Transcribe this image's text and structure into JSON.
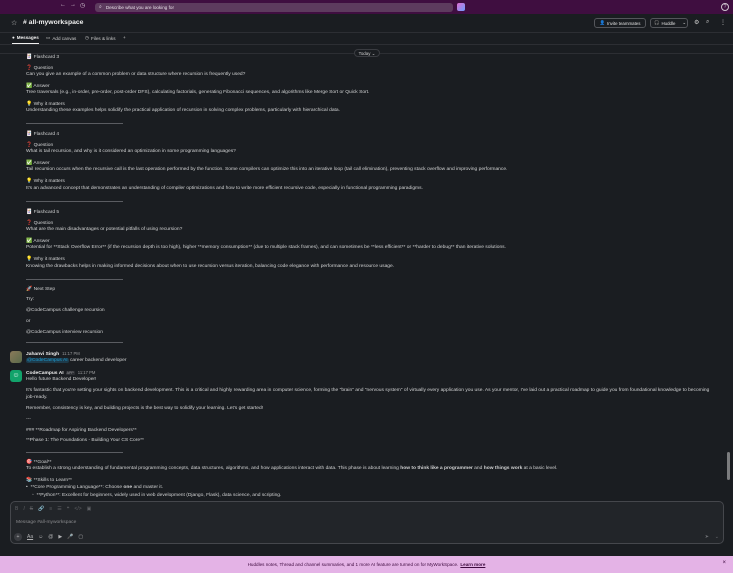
{
  "topbar": {
    "search_placeholder": "Describe what you are looking for",
    "help_label": "?"
  },
  "channel": {
    "name": "# all-myworkspace",
    "invite_label": "Invite teammates",
    "huddle_label": "Huddle"
  },
  "tabs": [
    {
      "label": "Messages"
    },
    {
      "label": "Add canvas"
    },
    {
      "label": "Files & links"
    }
  ],
  "date_divider": "Today",
  "flashcards": {
    "fc3_title": "Flashcard 3",
    "fc3_q_label": "Question",
    "fc3_q": "Can you give an example of a common problem or data structure where recursion is frequently used?",
    "fc3_a_label": "Answer",
    "fc3_a": "Tree traversals (e.g., in-order, pre-order, post-order DFS), calculating factorials, generating Fibonacci sequences, and algorithms like Merge Sort or Quick Sort.",
    "fc3_w_label": "Why it matters",
    "fc3_w": "Understanding these examples helps solidify the practical application of recursion in solving complex problems, particularly with hierarchical data.",
    "fc4_title": "Flashcard 4",
    "fc4_q_label": "Question",
    "fc4_q": "What is tail recursion, and why is it considered an optimization in some programming languages?",
    "fc4_a_label": "Answer",
    "fc4_a": "Tail recursion occurs when the recursive call is the last operation performed by the function. Some compilers can optimize this into an iterative loop (tail call elimination), preventing stack overflow and improving performance.",
    "fc4_w_label": "Why it matters",
    "fc4_w": "It's an advanced concept that demonstrates an understanding of compiler optimizations and how to write more efficient recursive code, especially in functional programming paradigms.",
    "fc5_title": "Flashcard 5",
    "fc5_q_label": "Question",
    "fc5_q": "What are the main disadvantages or potential pitfalls of using recursion?",
    "fc5_a_label": "Answer",
    "fc5_a": "Potential for **Stack Overflow Error** (if the recursion depth is too high), higher **memory consumption** (due to multiple stack frames), and can sometimes be **less efficient** or **harder to debug** than iterative solutions.",
    "fc5_w_label": "Why it matters",
    "fc5_w": "Knowing the drawbacks helps in making informed decisions about when to use recursion versus iteration, balancing code elegance with performance and resource usage.",
    "next_label": "Next Step",
    "try_label": "Try:",
    "try1": "@CodeCampus challenge recursion",
    "or_label": "or",
    "try2": "@CodeCampus interview recursion"
  },
  "msg_user": {
    "name": "Jahanvi Singh",
    "time": "11:17 PM",
    "mention": "@CodeCampus AI",
    "text": "career backend developer"
  },
  "msg_bot": {
    "name": "CodeCampus AI",
    "app": "APP",
    "time": "11:17 PM",
    "l1": "Hello future Backend Developer!",
    "l2": "It's fantastic that you're setting your sights on backend development. This is a critical and highly rewarding area in computer science, forming the \"brain\" and \"nervous system\" of virtually every application you use. As your mentor, I've laid out a practical roadmap to guide you from foundational knowledge to becoming job-ready.",
    "l3": "Remember, consistency is key, and building projects is the best way to solidify your learning. Let's get started!",
    "l4": "---",
    "l5": "### **Roadmap for Aspiring Backend Developers**",
    "l6": "**Phase 1: The Foundations - Building Your CS Core**",
    "goal_label": "**Goal**",
    "goal_a": "To establish a strong understanding of fundamental programming concepts, data structures, algorithms, and how applications interact with data. This phase is about learning ",
    "goal_b": "how to think like a programmer",
    "goal_c": " and ",
    "goal_d": "how things work",
    "goal_e": " at a basic level.",
    "skills_label": "**Skills to Learn**",
    "b1a": "**Core Programming Language**: Choose ",
    "b1b": "one",
    "b1c": " and master it.",
    "b2": "**Python**: Excellent for beginners, widely used in web development (Django, Flask), data science, and scripting."
  },
  "composer": {
    "placeholder": "Message #all-myworkspace",
    "aa_label": "Aa"
  },
  "banner": {
    "text": "Huddles notes, Thread and channel summaries, and 1 more AI feature are turned on for MyWorkSpace.",
    "link": "Learn more"
  },
  "colors": {
    "sidebar_purple": "#3f0e40",
    "background": "#1a1d21",
    "link_blue": "#1d9bd1",
    "banner_pink": "#e4b3e6"
  }
}
